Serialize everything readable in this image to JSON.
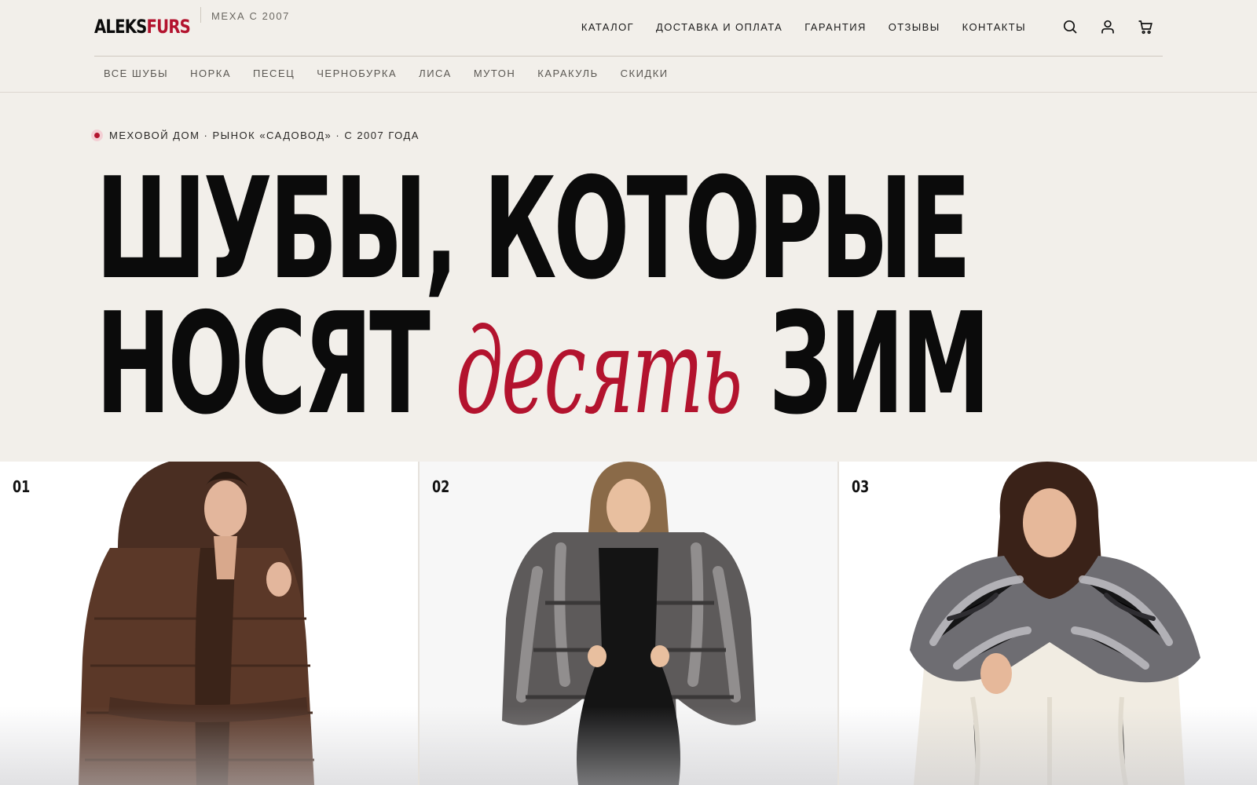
{
  "brand": {
    "name_part1": "ALEKS",
    "name_part2": "FURS",
    "tagline": "МЕХА С 2007",
    "accent_color": "#b3132e"
  },
  "main_nav": [
    {
      "label": "КАТАЛОГ"
    },
    {
      "label": "ДОСТАВКА И ОПЛАТА"
    },
    {
      "label": "ГАРАНТИЯ"
    },
    {
      "label": "ОТЗЫВЫ"
    },
    {
      "label": "КОНТАКТЫ"
    }
  ],
  "header_icons": [
    "search-icon",
    "user-icon",
    "cart-icon"
  ],
  "sub_nav": [
    {
      "label": "ВСЕ ШУБЫ"
    },
    {
      "label": "НОРКА"
    },
    {
      "label": "ПЕСЕЦ"
    },
    {
      "label": "ЧЕРНОБУРКА"
    },
    {
      "label": "ЛИСА"
    },
    {
      "label": "МУТОН"
    },
    {
      "label": "КАРАКУЛЬ"
    },
    {
      "label": "СКИДКИ"
    }
  ],
  "hero": {
    "eyebrow": "МЕХОВОЙ ДОМ · РЫНОК «САДОВОД» · С 2007 ГОДА",
    "line1": "ШУБЫ, КОТОРЫЕ",
    "line2_start": "НОСЯТ",
    "line2_accent": "десять",
    "line2_end": "ЗИМ"
  },
  "cards": [
    {
      "number": "01"
    },
    {
      "number": "02"
    },
    {
      "number": "03"
    }
  ]
}
